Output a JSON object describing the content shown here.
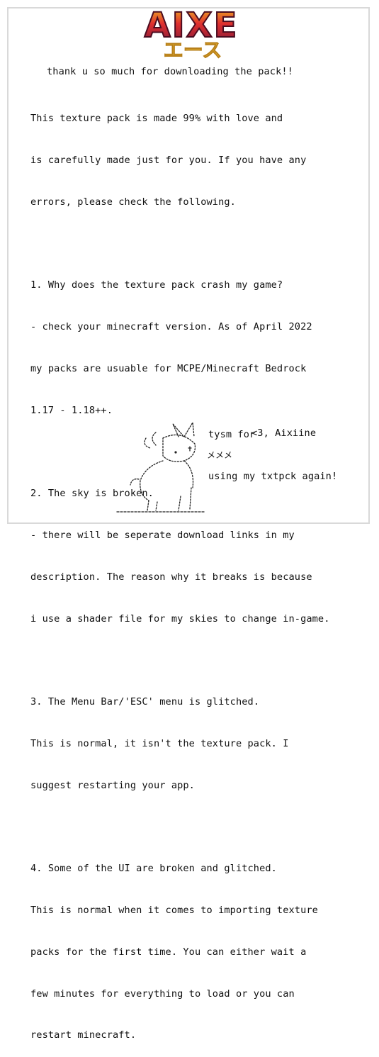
{
  "logo": {
    "text": "AIXE",
    "sub": "エース",
    "colors": {
      "top": "#f0c020",
      "mid": "#e03030",
      "bottom": "#8a1a3a",
      "sub": "#f4c33a"
    }
  },
  "intro": "thank u so much for downloading the pack!!",
  "body": [
    "This texture pack is made 99% with love and",
    "is carefully made just for you. If you have any",
    "errors, please check the following.",
    "",
    "1. Why does the texture pack crash my game?",
    "- check your minecraft version. As of April 2022",
    "my packs are usuable for MCPE/Minecraft Bedrock",
    "1.17 - 1.18++.",
    "",
    "2. The sky is broken.",
    "- there will be seperate download links in my",
    "description. The reason why it breaks is because",
    "i use a shader file for my skies to change in-game.",
    "",
    "3. The Menu Bar/'ESC' menu is glitched.",
    "This is normal, it isn't the texture pack. I",
    "suggest restarting your app.",
    "",
    "4. Some of the UI are broken and glitched.",
    "This is normal when it comes to importing texture",
    "packs for the first time. You can either wait a",
    "few minutes for everything to load or you can",
    "restart minecraft."
  ],
  "sign": {
    "line1": "tysm for",
    "line2": "using my txtpck again!",
    "line3": "<3, Aixiine"
  },
  "mascot": {
    "label": "メメメ"
  }
}
